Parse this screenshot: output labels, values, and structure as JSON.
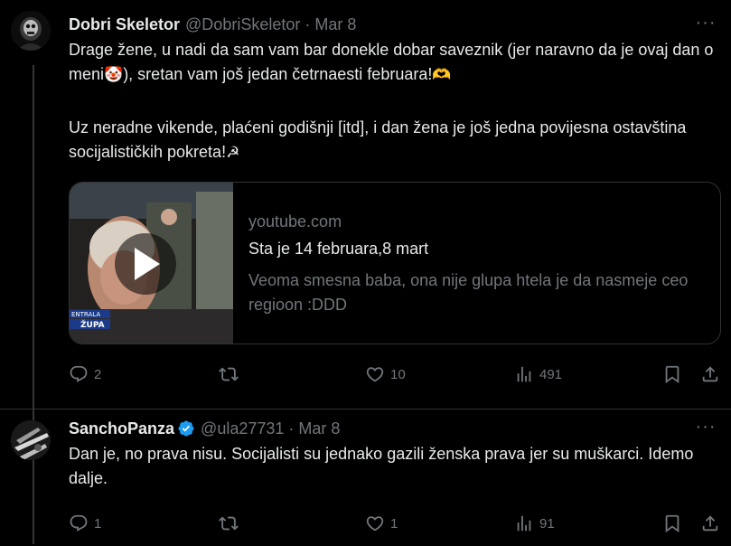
{
  "tweets": [
    {
      "name": "Dobri Skeletor",
      "handle": "@DobriSkeletor",
      "separator": "·",
      "date": "Mar 8",
      "paragraph1_a": "Drage žene, u nadi da sam vam bar donekle dobar saveznik (jer naravno da je ovaj dan o meni",
      "emoji_clown": "🤡",
      "paragraph1_b": "), sretan vam još jedan četrnaesti februara!",
      "emoji_heart_hands": "🫶",
      "paragraph2": "Uz neradne vikende, plaćeni godišnji [itd], i dan žena je još jedna povijesna ostavština socijalističkih pokreta!",
      "emoji_hammer_sickle": "☭",
      "card": {
        "domain": "youtube.com",
        "title": "Sta je 14 februara,8 mart",
        "description": "Veoma smesna baba, ona nije glupa htela je da nasmeje ceo regioon :DDD",
        "thumb_caption_1": "ENTRALA",
        "thumb_caption_2": "ŽUPA"
      },
      "replies": "2",
      "retweets": "",
      "likes": "10",
      "views": "491"
    },
    {
      "name": "SanchoPanza",
      "handle": "@ula27731",
      "separator": "·",
      "date": "Mar 8",
      "text": "Dan je, no prava nisu. Socijalisti su jednako gazili ženska prava jer su muškarci. Idemo dalje.",
      "replies": "1",
      "retweets": "",
      "likes": "1",
      "views": "91"
    }
  ],
  "more_label": "···",
  "colors": {
    "background": "#000000",
    "text_primary": "#e7e9ea",
    "text_secondary": "#71767b",
    "border": "#2f3336",
    "verified": "#1d9bf0"
  },
  "icons": [
    "more-icon",
    "reply-icon",
    "retweet-icon",
    "like-icon",
    "views-icon",
    "bookmark-icon",
    "share-icon",
    "verified-badge-icon",
    "play-icon"
  ]
}
